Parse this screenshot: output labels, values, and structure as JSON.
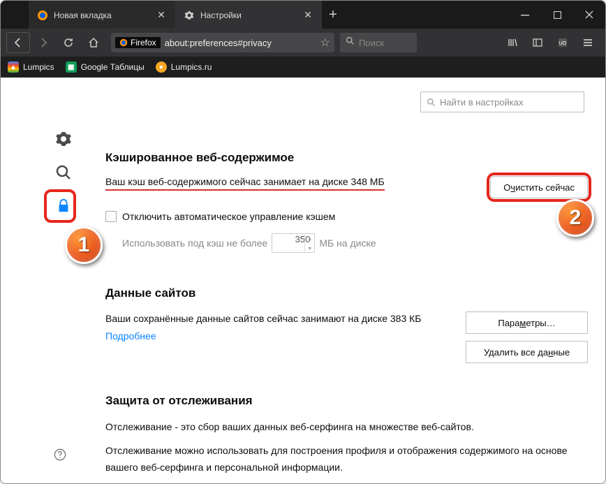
{
  "tabs": [
    {
      "label": "Новая вкладка",
      "active": false,
      "icon": "firefox"
    },
    {
      "label": "Настройки",
      "active": true,
      "icon": "gear"
    }
  ],
  "url": {
    "brand": "Firefox",
    "address": "about:preferences#privacy"
  },
  "searchbar": {
    "placeholder": "Поиск"
  },
  "bookmarks": [
    {
      "label": "Lumpics",
      "color": "#ff4500",
      "glyph": "▲"
    },
    {
      "label": "Google Таблицы",
      "color": "#0f9d58",
      "glyph": "▦"
    },
    {
      "label": "Lumpics.ru",
      "color": "#f4a823",
      "glyph": "●"
    }
  ],
  "prefs_search": {
    "placeholder": "Найти в настройках"
  },
  "cache": {
    "heading": "Кэшированное веб-содержимое",
    "status": "Ваш кэш веб-содержимого сейчас занимает на диске 348 МБ",
    "clear_btn": "Очистить сейчас",
    "clear_mnemonic": "ч",
    "checkbox_label": "Отключить автоматическое управление кэшем",
    "limit_prefix": "Использовать под кэш не более",
    "limit_value": "350",
    "limit_suffix": "МБ на диске"
  },
  "sitedata": {
    "heading": "Данные сайтов",
    "status": "Ваши сохранённые данные сайтов сейчас занимают на диске 383 КБ",
    "more": "Подробнее",
    "params_btn": "Параметры…",
    "params_mnemonic": "м",
    "delete_btn": "Удалить все данные",
    "delete_mnemonic": "н"
  },
  "tracking": {
    "heading": "Защита от отслеживания",
    "p1": "Отслеживание - это сбор ваших данных веб-серфинга на множестве веб-сайтов.",
    "p2": "Отслеживание можно использовать для построения профиля и отображения содержимого на основе вашего веб-серфинга и персональной информации."
  },
  "annotations": {
    "badge1": "1",
    "badge2": "2"
  }
}
